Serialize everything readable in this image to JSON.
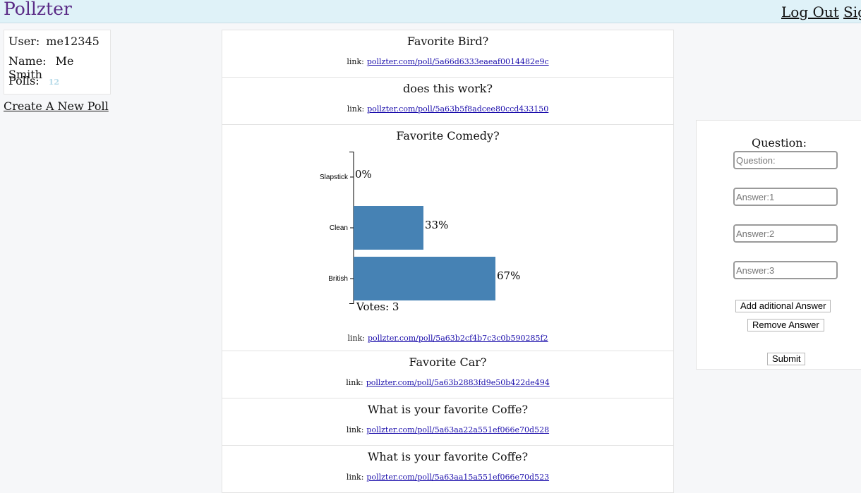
{
  "header": {
    "brand": "Pollzter",
    "logout": "Log Out",
    "signin_partial": "Sig"
  },
  "user": {
    "user_label": "User:",
    "user_value": "me12345",
    "name_label": "Name:",
    "name_value": "Me Smith",
    "polls_label": "Polls:",
    "polls_value": "12"
  },
  "create_poll": "Create A New Poll",
  "link_label": "link:",
  "polls": [
    {
      "title": "Favorite Bird?",
      "url": "pollzter.com/poll/5a66d6333eaeaf0014482e9c"
    },
    {
      "title": "does this work?",
      "url": "pollzter.com/poll/5a63b5f8adcee80ccd433150"
    },
    {
      "title": "Favorite Comedy?",
      "url": "pollzter.com/poll/5a63b2cf4b7c3c0b590285f2"
    },
    {
      "title": "Favorite Car?",
      "url": "pollzter.com/poll/5a63b2883fd9e50b422de494"
    },
    {
      "title": "What is your favorite Coffe?",
      "url": "pollzter.com/poll/5a63aa22a551ef066e70d528"
    },
    {
      "title": "What is your favorite Coffe?",
      "url": "pollzter.com/poll/5a63aa15a551ef066e70d523"
    }
  ],
  "chart_data": {
    "type": "bar",
    "orientation": "horizontal",
    "categories": [
      "Slapstick",
      "Clean",
      "British"
    ],
    "values": [
      0,
      33,
      67
    ],
    "value_labels": [
      "0%",
      "33%",
      "67%"
    ],
    "votes_label": "Votes: 3",
    "xlim": [
      0,
      100
    ],
    "bar_color": "#4682b4"
  },
  "form": {
    "question_label": "Question:",
    "question_placeholder": "Question:",
    "answer1_placeholder": "Answer:1",
    "answer2_placeholder": "Answer:2",
    "answer3_placeholder": "Answer:3",
    "add_answer": "Add aditional Answer",
    "remove_answer": "Remove Answer",
    "submit": "Submit"
  }
}
